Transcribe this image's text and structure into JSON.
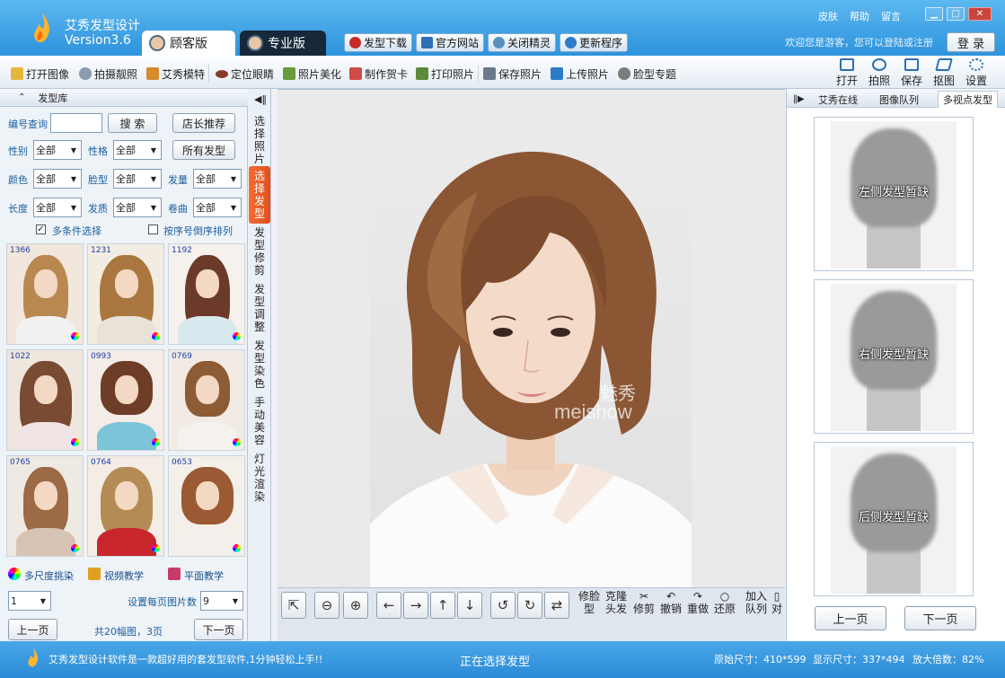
{
  "app": {
    "name": "艾秀发型设计",
    "version": "Version3.6",
    "tab_customer": "顾客版",
    "tab_pro": "专业版"
  },
  "topbar": {
    "buttons": [
      "发型下载",
      "官方网站",
      "关闭精灵",
      "更新程序"
    ],
    "links": [
      "皮肤",
      "帮助",
      "留言"
    ],
    "welcome": "欢迎您是游客，您可以登陆或注册",
    "login": "登 录"
  },
  "toolbar": {
    "items": [
      "打开图像",
      "拍摄靓照",
      "艾秀模特",
      "定位眼睛",
      "照片美化",
      "制作贺卡",
      "打印照片",
      "保存照片",
      "上传照片",
      "脸型专题"
    ],
    "right": [
      "打开",
      "拍照",
      "保存",
      "抠图",
      "设置"
    ]
  },
  "library": {
    "title": "发型库",
    "search_label": "编号查询",
    "search_value": "",
    "search_button": "搜 索",
    "recommend_button": "店长推荐",
    "all_button": "所有发型",
    "filters": [
      {
        "label": "性别",
        "value": "全部"
      },
      {
        "label": "性格",
        "value": "全部"
      },
      {
        "label": "颜色",
        "value": "全部"
      },
      {
        "label": "脸型",
        "value": "全部"
      },
      {
        "label": "发量",
        "value": "全部"
      },
      {
        "label": "长度",
        "value": "全部"
      },
      {
        "label": "发质",
        "value": "全部"
      },
      {
        "label": "卷曲",
        "value": "全部"
      }
    ],
    "multi_label": "多条件选择",
    "multi_checked": true,
    "reverse_label": "按序号倒序排列",
    "reverse_checked": false,
    "thumbnails": [
      "1366",
      "1231",
      "1192",
      "1022",
      "0993",
      "0769",
      "0765",
      "0764",
      "0653"
    ],
    "links": [
      "多尺度挑染",
      "视频教学",
      "平面教学"
    ],
    "page_value": "1",
    "per_page_label": "设置每页图片数",
    "per_page_value": "9",
    "prev": "上一页",
    "next": "下一页",
    "summary": "共20幅图，3页"
  },
  "vtabs": [
    "选择照片",
    "选择发型",
    "发型修剪",
    "发型调整",
    "发型染色",
    "手动美容",
    "灯光渲染"
  ],
  "watermark": {
    "cn": "魅秀",
    "en": "meishow"
  },
  "edit_toolbar": [
    "修脸型",
    "克隆头发",
    "修剪",
    "撤销",
    "重做",
    "还原",
    "加入队列",
    "对"
  ],
  "right_panel": {
    "tabs": [
      "艾秀在线",
      "图像队列",
      "多视点发型"
    ],
    "views": [
      "左侧发型暂缺",
      "右侧发型暂缺",
      "后侧发型暂缺"
    ],
    "prev": "上一页",
    "next": "下一页"
  },
  "status": {
    "tip": "艾秀发型设计软件是一款超好用的套发型软件,1分钟轻松上手!!",
    "state": "正在选择发型",
    "orig": "原始尺寸：410*599",
    "disp": "显示尺寸：337*494",
    "zoom": "放大倍数：82%"
  },
  "colors": {
    "header": "#2d93dc",
    "active_tab": "#e04e1c",
    "label": "#1d5e9c"
  }
}
